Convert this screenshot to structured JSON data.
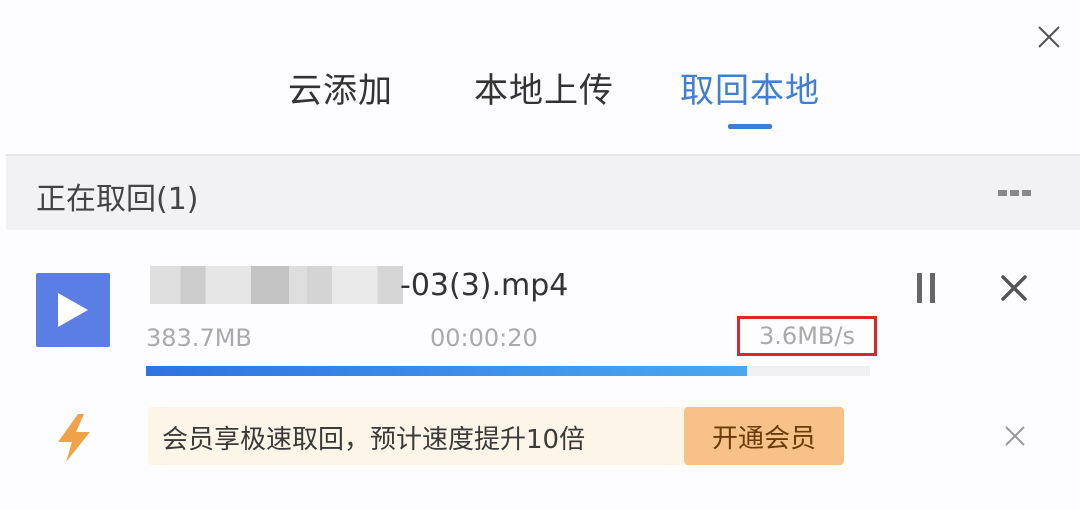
{
  "dialog": {
    "close_icon": "close-icon"
  },
  "tabs": [
    {
      "label": "云添加"
    },
    {
      "label": "本地上传"
    },
    {
      "label": "取回本地",
      "active": true
    }
  ],
  "section": {
    "title": "正在取回(1)",
    "menu_icon": "list-options-icon"
  },
  "task": {
    "file_icon": "video-play-icon",
    "file_name_visible": "-03(3).mp4",
    "size": "383.7MB",
    "elapsed": "00:00:20",
    "speed": "3.6MB/s",
    "progress_percent": 83,
    "accent_color": "#3f7ed8",
    "highlight_color": "#d9272d"
  },
  "vip": {
    "icon": "lightning-icon",
    "text": "会员享极速取回，预计速度提升10倍",
    "button_label": "开通会员"
  }
}
